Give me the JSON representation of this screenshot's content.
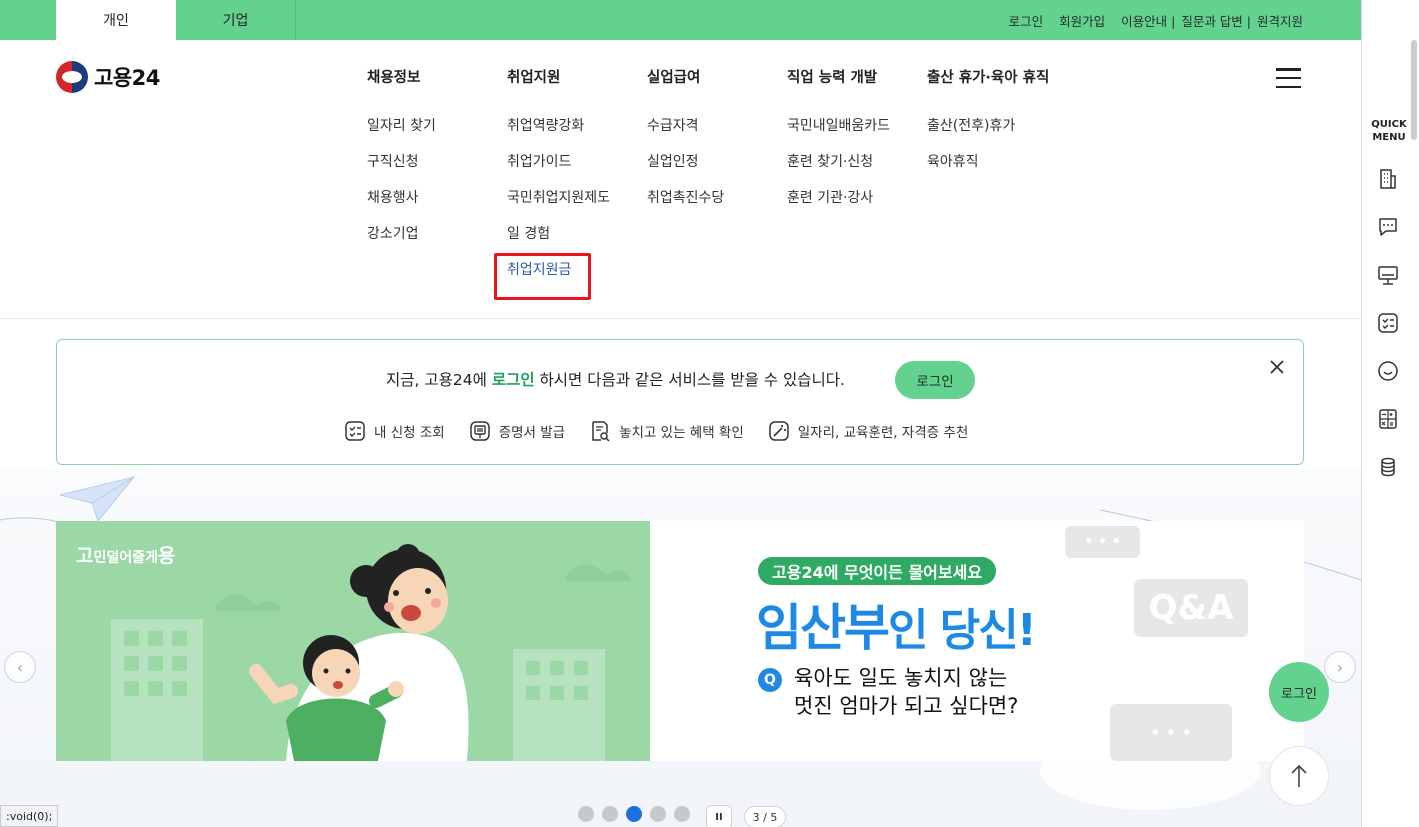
{
  "topbar": {
    "tabs": [
      "개인",
      "기업"
    ],
    "links": [
      "로그인",
      "회원가입",
      "이용안내 |",
      "질문과 답변 |",
      "원격지원"
    ]
  },
  "logo": {
    "text": "고용24"
  },
  "nav": [
    {
      "head": "채용정보",
      "items": [
        "일자리 찾기",
        "구직신청",
        "채용행사",
        "강소기업"
      ]
    },
    {
      "head": "취업지원",
      "items": [
        "취업역량강화",
        "취업가이드",
        "국민취업지원제도",
        "일 경험",
        "취업지원금"
      ]
    },
    {
      "head": "실업급여",
      "items": [
        "수급자격",
        "실업인정",
        "취업촉진수당"
      ]
    },
    {
      "head": "직업 능력 개발",
      "items": [
        "국민내일배움카드",
        "훈련 찾기·신청",
        "훈련 기관·강사"
      ]
    },
    {
      "head": "출산 휴가·육아 휴직",
      "items": [
        "출산(전후)휴가",
        "육아휴직"
      ]
    }
  ],
  "highlighted_item": "취업지원금",
  "quick_menu": {
    "title_line1": "QUICK",
    "title_line2": "MENU",
    "icons": [
      "building-icon",
      "chat-icon",
      "monitor-icon",
      "checklist-icon",
      "smile-icon",
      "calculator-icon",
      "coins-icon"
    ]
  },
  "login_banner": {
    "text_before": "지금, 고용24에 ",
    "text_highlight": "로그인",
    "text_after": " 하시면 다음과 같은 서비스를 받을 수 있습니다.",
    "button": "로그인",
    "services": [
      "내 신청 조회",
      "증명서 발급",
      "놓치고 있는 혜택 확인",
      "일자리, 교육훈련, 자격증 추천"
    ]
  },
  "slide": {
    "tag_big1": "고",
    "tag_small": "민덜어줄게",
    "tag_big2": "용",
    "pill": "고용24에 무엇이든 물어보세요",
    "headline_strong": "임산부",
    "headline_rest": "인 당신!",
    "q_label": "Q",
    "q_line1": "육아도 일도 놓치지 않는",
    "q_line2": "멋진 엄마가 되고 싶다면?",
    "bubble_qa": "Q&A",
    "bubble_dots": "• • •"
  },
  "floating": {
    "login": "로그인"
  },
  "pagination": {
    "pause": "II",
    "counter": "3 / 5",
    "count": 5,
    "active_index": 3
  },
  "statusbar": {
    "text": ":void(0);"
  },
  "colors": {
    "brand_green": "#63d28f",
    "highlight_red": "#e8141a",
    "accent_blue": "#1e88e5"
  }
}
